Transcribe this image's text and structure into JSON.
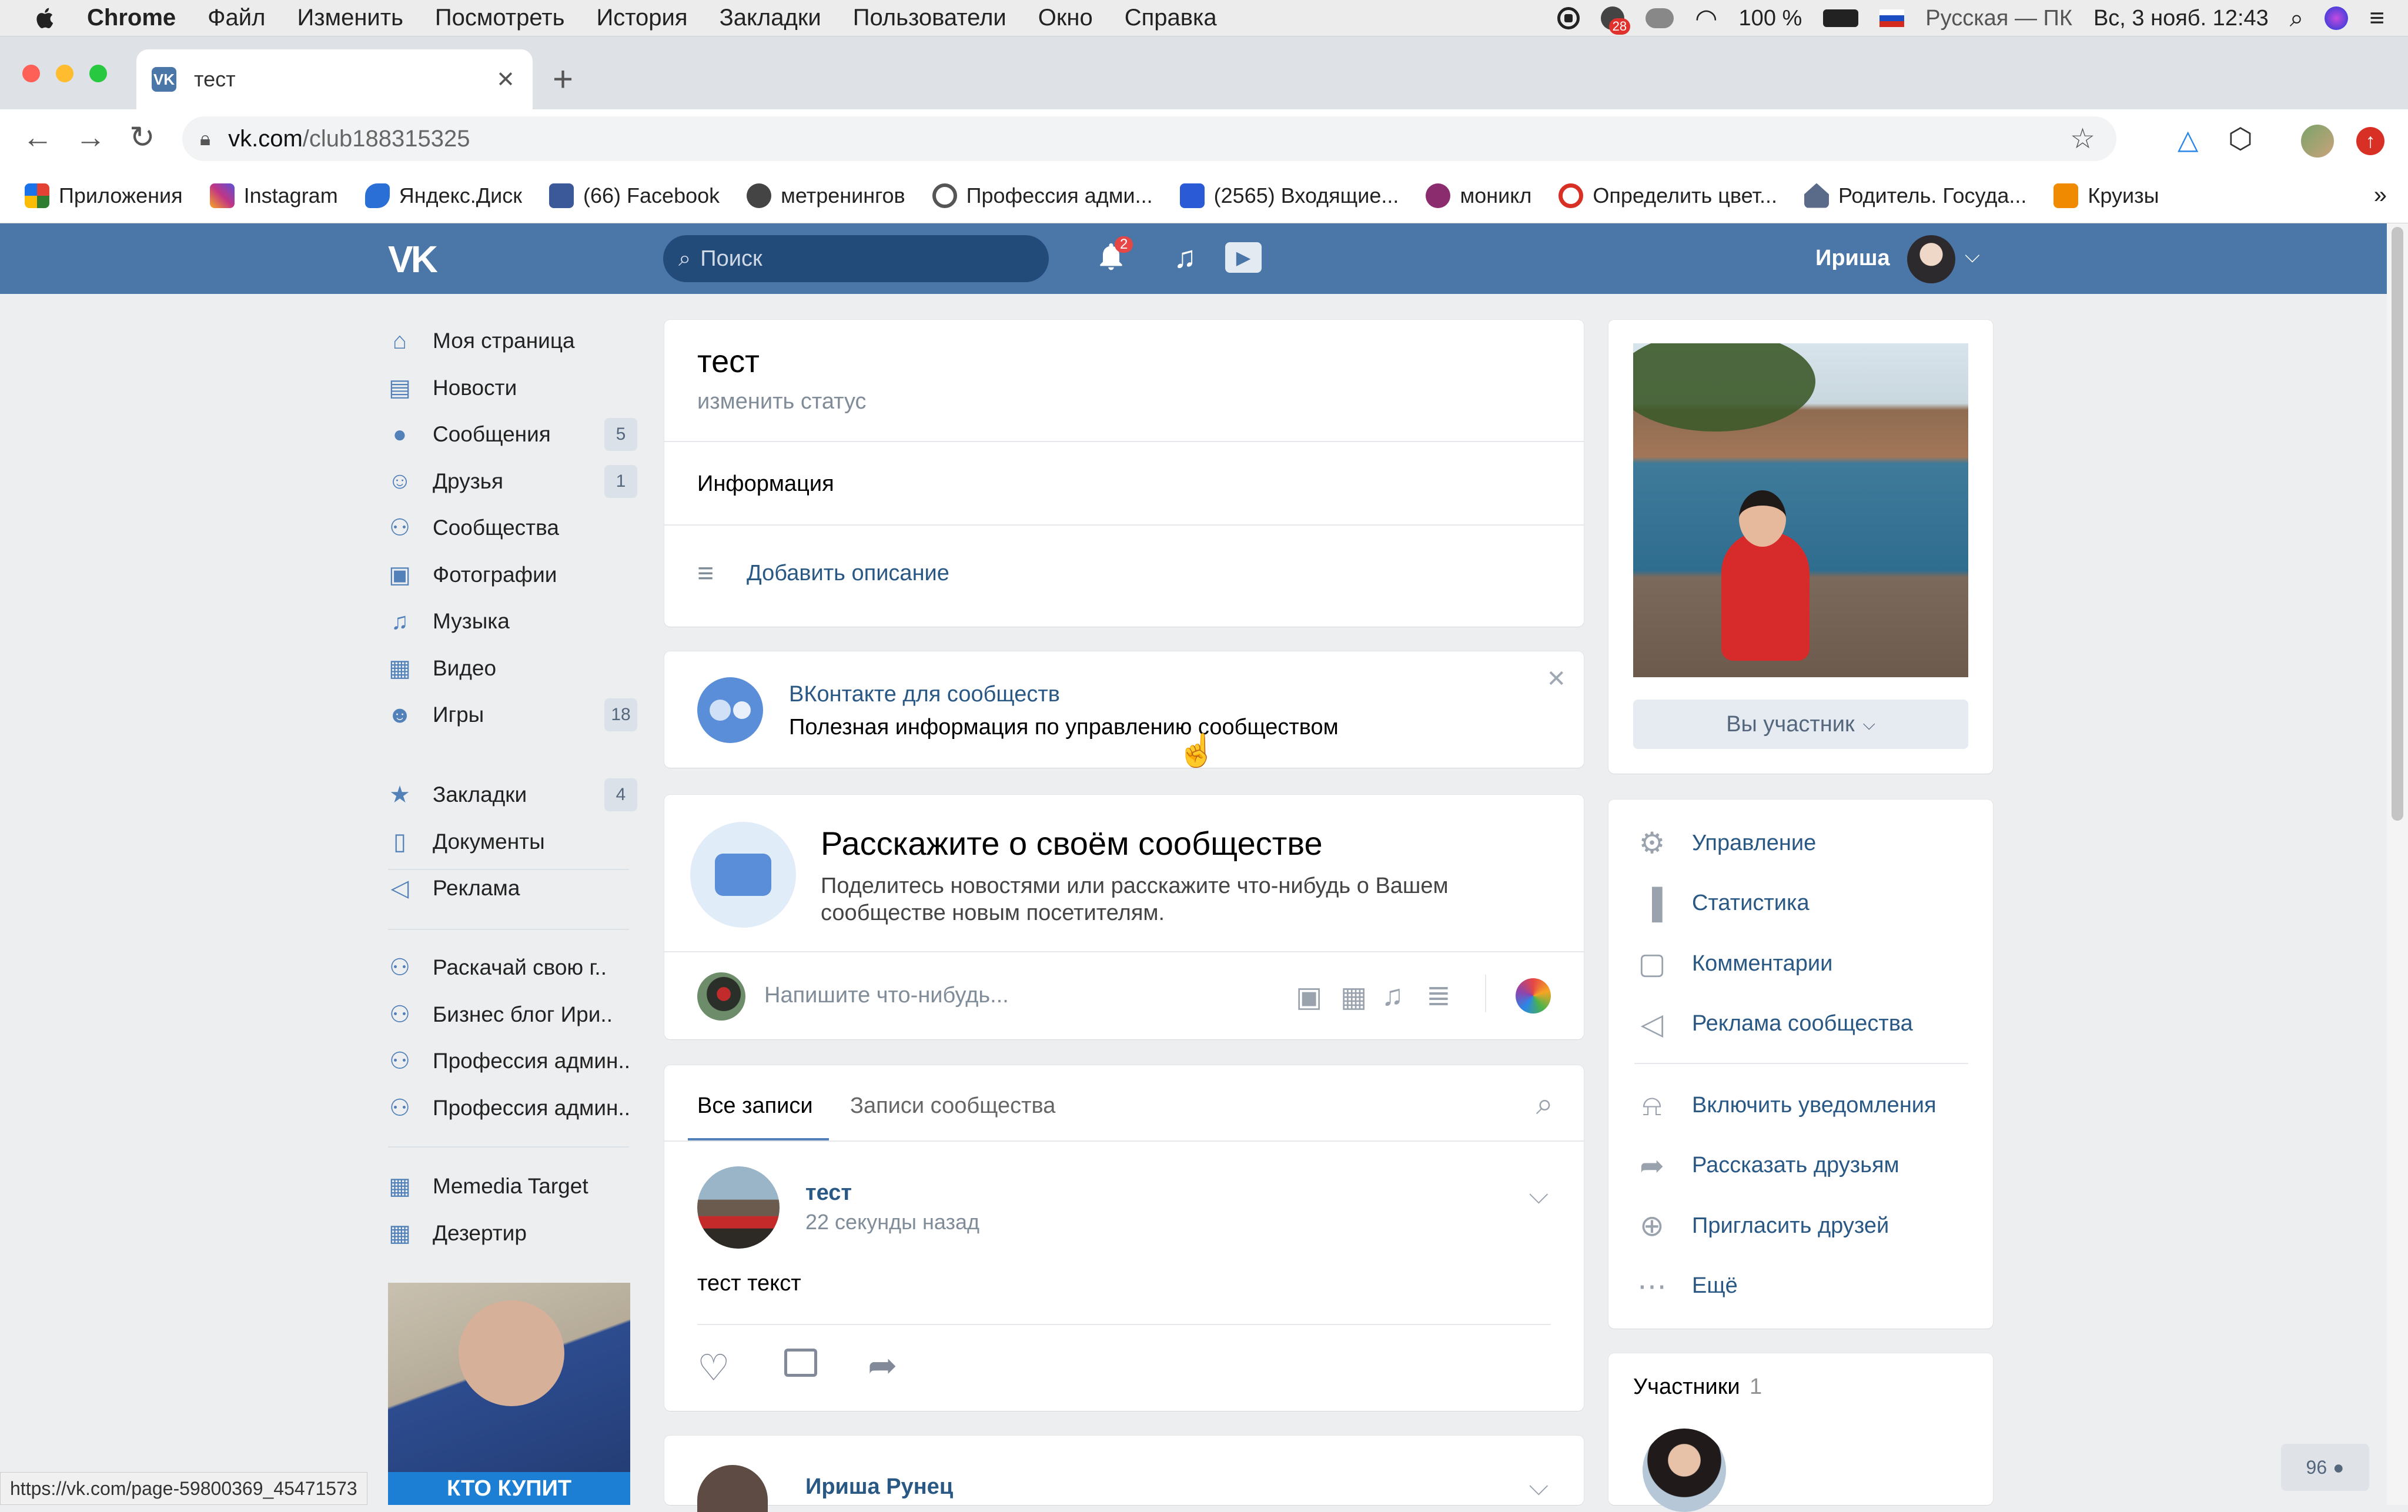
{
  "menubar": {
    "app": "Chrome",
    "items": [
      "Файл",
      "Изменить",
      "Посмотреть",
      "История",
      "Закладки",
      "Пользователи",
      "Окно",
      "Справка"
    ],
    "notif_badge": "28",
    "battery": "100 %",
    "input_source": "Русская — ПК",
    "datetime": "Вс, 3 нояб. 12:43"
  },
  "browser": {
    "tab_title": "тест",
    "url_host": "vk.com",
    "url_path": "/club188315325",
    "bookmarks": [
      {
        "label": "Приложения",
        "icon": "apps-grid-icon",
        "color": "#e34133"
      },
      {
        "label": "Instagram",
        "icon": "instagram-icon",
        "color": "#c13584"
      },
      {
        "label": "Яндекс.Диск",
        "icon": "yandex-disk-icon",
        "color": "#2a6fd6"
      },
      {
        "label": "(66) Facebook",
        "icon": "facebook-icon",
        "color": "#3b5998"
      },
      {
        "label": "метренингов",
        "icon": "globe-icon",
        "color": "#444444"
      },
      {
        "label": "Профессия адми...",
        "icon": "target-icon",
        "color": "#555555"
      },
      {
        "label": "(2565) Входящие...",
        "icon": "mail-icon",
        "color": "#2a5ad6"
      },
      {
        "label": "моникл",
        "icon": "circle-logo-icon",
        "color": "#8a2c6d"
      },
      {
        "label": "Определить цвет...",
        "icon": "gear-red-icon",
        "color": "#d93025"
      },
      {
        "label": "Родитель. Госуда...",
        "icon": "house-icon",
        "color": "#5a6b8a"
      },
      {
        "label": "Круизы",
        "icon": "in-logo-icon",
        "color": "#f08a00"
      }
    ],
    "status_url": "https://vk.com/page-59800369_45471573"
  },
  "vk": {
    "search_placeholder": "Поиск",
    "notif_count": "2",
    "user_name": "Ириша",
    "left_menu": [
      {
        "label": "Моя страница",
        "icon": "home-icon",
        "count": ""
      },
      {
        "label": "Новости",
        "icon": "news-icon",
        "count": ""
      },
      {
        "label": "Сообщения",
        "icon": "messages-icon",
        "count": "5"
      },
      {
        "label": "Друзья",
        "icon": "friend-icon",
        "count": "1"
      },
      {
        "label": "Сообщества",
        "icon": "groups-icon",
        "count": ""
      },
      {
        "label": "Фотографии",
        "icon": "camera-icon",
        "count": ""
      },
      {
        "label": "Музыка",
        "icon": "music-icon",
        "count": ""
      },
      {
        "label": "Видео",
        "icon": "video-icon",
        "count": ""
      },
      {
        "label": "Игры",
        "icon": "games-icon",
        "count": "18"
      }
    ],
    "left_menu_2": [
      {
        "label": "Закладки",
        "icon": "star-icon",
        "count": "4"
      },
      {
        "label": "Документы",
        "icon": "document-icon",
        "count": ""
      },
      {
        "label": "Реклама",
        "icon": "megaphone-icon",
        "count": ""
      }
    ],
    "left_menu_3": [
      {
        "label": "Раскачай свою г..",
        "icon": "groups-icon"
      },
      {
        "label": "Бизнес блог Ири..",
        "icon": "groups-icon"
      },
      {
        "label": "Профессия админ..",
        "icon": "groups-icon"
      },
      {
        "label": "Профессия админ..",
        "icon": "groups-icon"
      }
    ],
    "left_menu_4": [
      {
        "label": "Memedia Target",
        "icon": "apps-icon"
      },
      {
        "label": "Дезертир",
        "icon": "apps-icon"
      }
    ],
    "promo_caption": "КТО КУПИТ",
    "group": {
      "name": "тест",
      "status_link": "изменить статус",
      "info_heading": "Информация",
      "add_description": "Добавить описание"
    },
    "banner": {
      "title": "ВКонтакте для сообществ",
      "text": "Полезная информация по управлению сообществом"
    },
    "tell": {
      "title": "Расскажите о своём сообществе",
      "text_line1": "Поделитесь новостями или расскажите что-нибудь о Вашем",
      "text_line2": "сообществе новым посетителям.",
      "compose_placeholder": "Напишите что-нибудь..."
    },
    "tabs": {
      "all": "Все записи",
      "community": "Записи сообщества"
    },
    "post": {
      "author": "тест",
      "time": "22 секунды назад",
      "text": "тест текст"
    },
    "post2_author": "Ириша Рунец",
    "member_button": "Вы участник",
    "actions": [
      {
        "label": "Управление",
        "icon": "gear-icon"
      },
      {
        "label": "Статистика",
        "icon": "stats-icon"
      },
      {
        "label": "Комментарии",
        "icon": "comment-icon"
      },
      {
        "label": "Реклама сообщества",
        "icon": "megaphone-icon"
      }
    ],
    "actions_2": [
      {
        "label": "Включить уведомления",
        "icon": "bell-icon"
      },
      {
        "label": "Рассказать друзьям",
        "icon": "share-icon"
      },
      {
        "label": "Пригласить друзей",
        "icon": "add-user-icon"
      },
      {
        "label": "Ещё",
        "icon": "more-icon"
      }
    ],
    "members_title": "Участники",
    "members_count": "1",
    "online_count": "96",
    "colors": {
      "header": "#4a76a8",
      "link": "#2a5885",
      "background": "#edeef0"
    }
  }
}
